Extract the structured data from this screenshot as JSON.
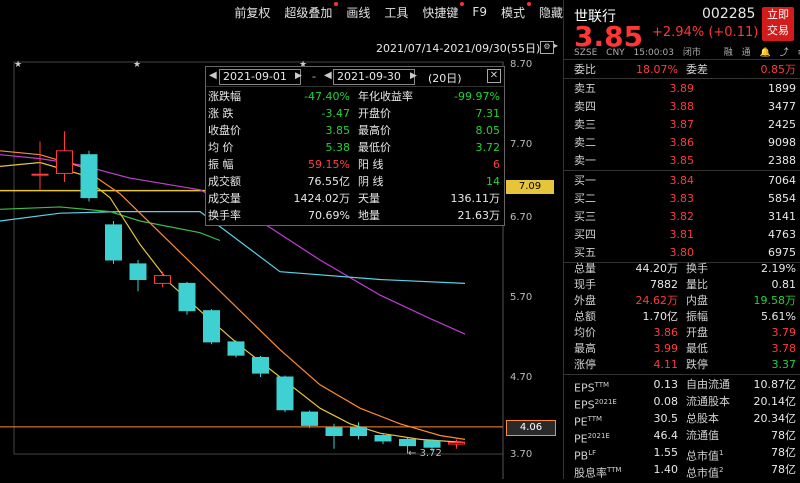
{
  "toolbar": {
    "items": [
      {
        "label": "前复权",
        "dot": false
      },
      {
        "label": "超级叠加",
        "dot": true
      },
      {
        "label": "画线",
        "dot": false
      },
      {
        "label": "工具",
        "dot": false
      },
      {
        "label": "快捷键",
        "dot": true
      },
      {
        "label": "F9",
        "dot": false
      },
      {
        "label": "模式",
        "dot": true
      },
      {
        "label": "隐藏",
        "dot": false
      }
    ]
  },
  "chart": {
    "range_label": "2021/07/14-2021/09/30(55日)",
    "y_ticks": [
      "8.70",
      "7.70",
      "6.70",
      "5.70",
      "4.70",
      "3.70"
    ],
    "price_tag_high": "7.09",
    "price_tag_low": "4.06",
    "min_label": "3.72",
    "candles": [
      {
        "o": 7.3,
        "h": 7.72,
        "l": 7.1,
        "c": 7.3
      },
      {
        "o": 7.31,
        "h": 7.85,
        "l": 7.2,
        "c": 7.6
      },
      {
        "o": 7.55,
        "h": 7.6,
        "l": 6.95,
        "c": 7.0
      },
      {
        "o": 6.65,
        "h": 6.7,
        "l": 6.15,
        "c": 6.2
      },
      {
        "o": 6.15,
        "h": 6.2,
        "l": 5.8,
        "c": 5.95
      },
      {
        "o": 5.9,
        "h": 6.05,
        "l": 5.85,
        "c": 6.0
      },
      {
        "o": 5.9,
        "h": 5.92,
        "l": 5.5,
        "c": 5.55
      },
      {
        "o": 5.55,
        "h": 5.57,
        "l": 5.12,
        "c": 5.15
      },
      {
        "o": 5.15,
        "h": 5.17,
        "l": 4.95,
        "c": 4.98
      },
      {
        "o": 4.95,
        "h": 4.97,
        "l": 4.7,
        "c": 4.75
      },
      {
        "o": 4.7,
        "h": 4.72,
        "l": 4.25,
        "c": 4.28
      },
      {
        "o": 4.25,
        "h": 4.27,
        "l": 4.05,
        "c": 4.08
      },
      {
        "o": 4.05,
        "h": 4.1,
        "l": 3.78,
        "c": 3.95
      },
      {
        "o": 4.05,
        "h": 4.12,
        "l": 3.9,
        "c": 3.95
      },
      {
        "o": 3.95,
        "h": 3.97,
        "l": 3.84,
        "c": 3.88
      },
      {
        "o": 3.9,
        "h": 3.92,
        "l": 3.72,
        "c": 3.82
      },
      {
        "o": 3.88,
        "h": 3.9,
        "l": 3.75,
        "c": 3.8
      },
      {
        "o": 3.84,
        "h": 3.9,
        "l": 3.78,
        "c": 3.86
      }
    ],
    "colors": {
      "up": "#ff3b3b",
      "down": "#3fd1d1",
      "ma_yellow": "#e6c53a",
      "ma_orange": "#ff8a30",
      "ma_purple": "#c43dd8",
      "ma_cyan": "#5ad2e6",
      "ma_green": "#3fbd4a"
    }
  },
  "popup": {
    "date_from": "2021-09-01",
    "dash": "-",
    "date_to": "2021-09-30",
    "days": "(20日)",
    "rows": [
      {
        "l1": "涨跌幅",
        "v1": "-47.40%",
        "c1": "green",
        "l2": "年化收益率",
        "v2": "-99.97%",
        "c2": "green"
      },
      {
        "l1": "涨    跌",
        "v1": "-3.47",
        "c1": "green",
        "l2": "开盘价",
        "v2": "7.31",
        "c2": "green"
      },
      {
        "l1": "收盘价",
        "v1": "3.85",
        "c1": "green",
        "l2": "最高价",
        "v2": "8.05",
        "c2": "green"
      },
      {
        "l1": "均    价",
        "v1": "5.38",
        "c1": "green",
        "l2": "最低价",
        "v2": "3.72",
        "c2": "green"
      },
      {
        "l1": "振    幅",
        "v1": "59.15%",
        "c1": "red",
        "l2": "阳    线",
        "v2": "6",
        "c2": "red"
      },
      {
        "l1": "成交额",
        "v1": "76.55亿",
        "c1": "white",
        "l2": "阴    线",
        "v2": "14",
        "c2": "green"
      },
      {
        "l1": "成交量",
        "v1": "1424.02万",
        "c1": "white",
        "l2": "天量",
        "v2": "136.11万",
        "c2": "white"
      },
      {
        "l1": "换手率",
        "v1": "70.69%",
        "c1": "white",
        "l2": "地量",
        "v2": "21.63万",
        "c2": "white"
      }
    ]
  },
  "quote": {
    "name": "世联行",
    "code": "002285",
    "trade_btn": [
      "立即",
      "交易"
    ],
    "price": "3.85",
    "change": "+2.94% (+0.11)",
    "meta": [
      "SZSE",
      "CNY",
      "15:00:03",
      "闭市",
      "融",
      "通"
    ],
    "weibi": {
      "l1": "委比",
      "v1": "18.07%",
      "l2": "委差",
      "v2": "0.85万"
    },
    "asks": [
      {
        "label": "卖五",
        "price": "3.89",
        "vol": "1899"
      },
      {
        "label": "卖四",
        "price": "3.88",
        "vol": "3477"
      },
      {
        "label": "卖三",
        "price": "3.87",
        "vol": "2425"
      },
      {
        "label": "卖二",
        "price": "3.86",
        "vol": "9098"
      },
      {
        "label": "卖一",
        "price": "3.85",
        "vol": "2388"
      }
    ],
    "bids": [
      {
        "label": "买一",
        "price": "3.84",
        "vol": "7064"
      },
      {
        "label": "买二",
        "price": "3.83",
        "vol": "5854"
      },
      {
        "label": "买三",
        "price": "3.82",
        "vol": "3141"
      },
      {
        "label": "买四",
        "price": "3.81",
        "vol": "4763"
      },
      {
        "label": "买五",
        "price": "3.80",
        "vol": "6975"
      }
    ],
    "stats": [
      {
        "l1": "总量",
        "v1": "44.20万",
        "c1": "white",
        "l2": "换手",
        "v2": "2.19%",
        "c2": "white"
      },
      {
        "l1": "现手",
        "v1": "7882",
        "c1": "white",
        "l2": "量比",
        "v2": "0.81",
        "c2": "white"
      },
      {
        "l1": "外盘",
        "v1": "24.62万",
        "c1": "red",
        "l2": "内盘",
        "v2": "19.58万",
        "c2": "green"
      },
      {
        "l1": "总额",
        "v1": "1.70亿",
        "c1": "white",
        "l2": "振幅",
        "v2": "5.61%",
        "c2": "white"
      },
      {
        "l1": "均价",
        "v1": "3.86",
        "c1": "red",
        "l2": "开盘",
        "v2": "3.79",
        "c2": "red"
      },
      {
        "l1": "最高",
        "v1": "3.99",
        "c1": "red",
        "l2": "最低",
        "v2": "3.78",
        "c2": "red"
      },
      {
        "l1": "涨停",
        "v1": "4.11",
        "c1": "red",
        "l2": "跌停",
        "v2": "3.37",
        "c2": "green"
      }
    ],
    "fundamentals": [
      {
        "l1": "EPS",
        "s1": "TTM",
        "v1": "0.13",
        "l2": "自由流通",
        "v2": "10.87亿"
      },
      {
        "l1": "EPS",
        "s1": "2021E",
        "v1": "0.08",
        "l2": "流通股本",
        "v2": "20.14亿"
      },
      {
        "l1": "PE",
        "s1": "TTM",
        "v1": "30.5",
        "l2": "总股本",
        "v2": "20.34亿"
      },
      {
        "l1": "PE",
        "s1": "2021E",
        "v1": "46.4",
        "l2": "流通值",
        "v2": "78亿"
      },
      {
        "l1": "PB",
        "s1": "LF",
        "v1": "1.55",
        "l2": "总市值",
        "s2": "1",
        "v2": "78亿"
      },
      {
        "l1": "股息率",
        "s1": "TTM",
        "v1": "1.40",
        "l2": "总市值",
        "s2": "2",
        "v2": "78亿"
      }
    ]
  }
}
